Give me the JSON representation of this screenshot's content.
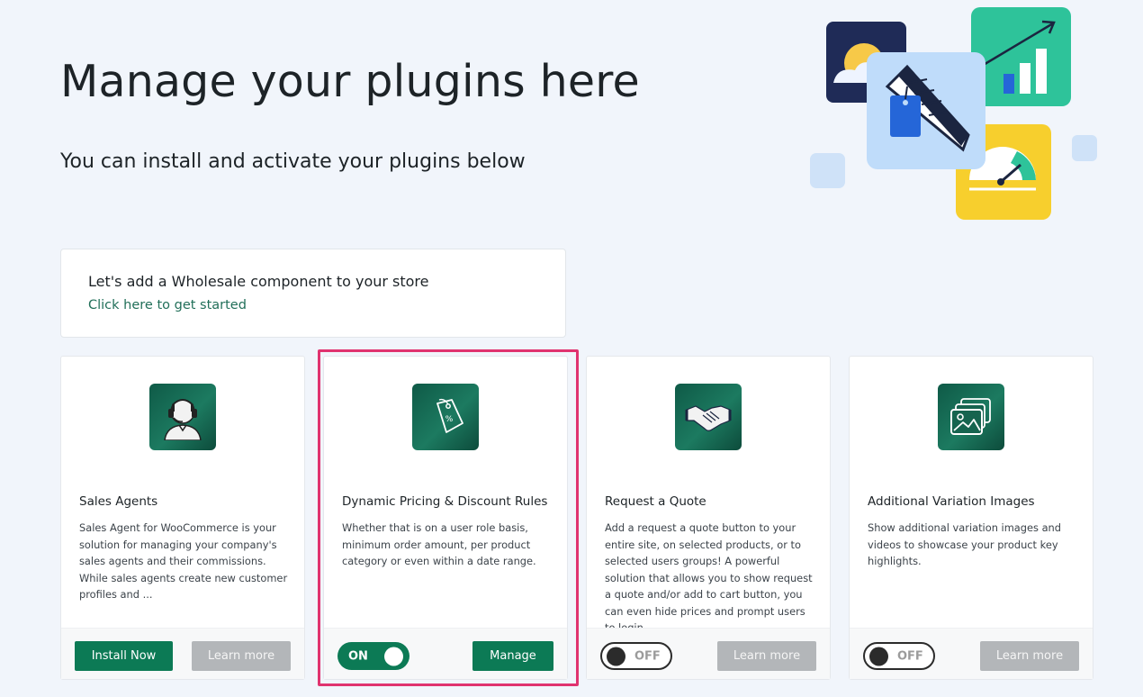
{
  "header": {
    "title": "Manage your plugins here",
    "subtitle": "You can install and activate your plugins below"
  },
  "cta": {
    "title": "Let's add a Wholesale component to your store",
    "link": "Click here to get started"
  },
  "plugins": [
    {
      "title": "Sales Agents",
      "icon": "headset-agent-icon",
      "description": "Sales Agent for WooCommerce is your solution for managing your company's sales agents and their commissions. While sales agents create new customer profiles and ...",
      "primary_label": "Install Now",
      "secondary_label": "Learn more"
    },
    {
      "title": "Dynamic Pricing & Discount Rules",
      "icon": "price-tag-icon",
      "description": "Whether that is on a user role basis, minimum order amount, per product category or even within a date range.",
      "toggle_label": "ON",
      "toggle_state": "on",
      "primary_label": "Manage"
    },
    {
      "title": "Request a Quote",
      "icon": "handshake-icon",
      "description": "Add a request a quote button to your entire site, on selected products, or to selected users groups! A powerful solution that allows you to show request a quote and/or add to cart button, you can even hide prices and prompt users to login.",
      "toggle_label": "OFF",
      "toggle_state": "off",
      "secondary_label": "Learn more"
    },
    {
      "title": "Additional Variation Images",
      "icon": "image-gallery-icon",
      "description": "Show additional variation images and videos to showcase your product key highlights.",
      "toggle_label": "OFF",
      "toggle_state": "off",
      "secondary_label": "Learn more"
    }
  ],
  "colors": {
    "background": "#f1f5fb",
    "accent": "#0c7a55",
    "highlight": "#e0336f",
    "muted_button": "#b3b6b9"
  }
}
